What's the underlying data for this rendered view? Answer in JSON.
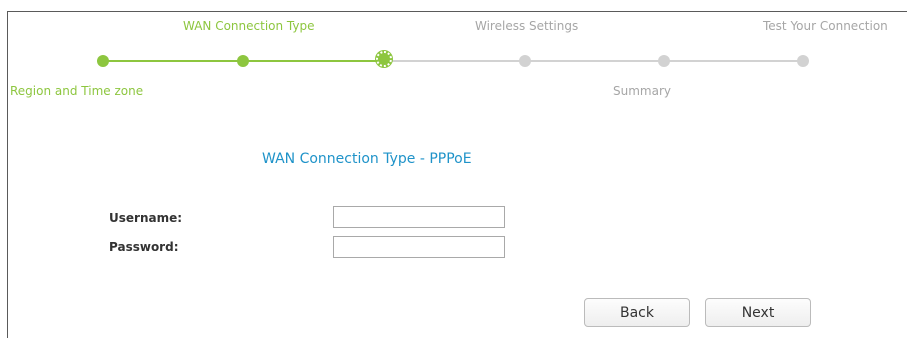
{
  "wizard": {
    "steps_top": [
      {
        "label": "WAN Connection Type",
        "state": "done"
      },
      {
        "label": "Wireless Settings",
        "state": "pending"
      },
      {
        "label": "Test Your Connection",
        "state": "pending"
      }
    ],
    "steps_bottom": [
      {
        "label": "Region and Time zone",
        "state": "done"
      },
      {
        "label": "Summary",
        "state": "pending"
      }
    ],
    "current_step": "WAN Connection Type",
    "colors": {
      "done": "#8dc63f",
      "pending": "#d2d2d2",
      "title": "#1f93c9"
    }
  },
  "form": {
    "title": "WAN Connection Type - PPPoE",
    "username_label": "Username:",
    "username_value": "",
    "password_label": "Password:",
    "password_value": ""
  },
  "buttons": {
    "back": "Back",
    "next": "Next"
  }
}
